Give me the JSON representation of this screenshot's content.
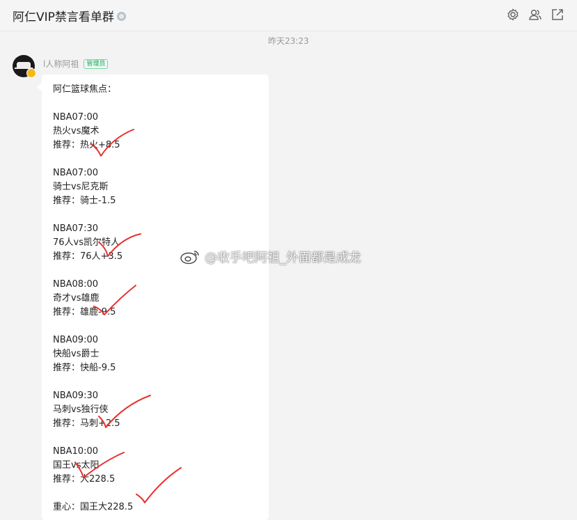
{
  "header": {
    "title": "阿仁VIP禁言看单群",
    "icons": [
      "gear-icon",
      "members-icon",
      "share-icon"
    ]
  },
  "timestamp": "昨天23:23",
  "message": {
    "sender": "l人称阿祖",
    "role": "管理员",
    "title": "阿仁篮球焦点：",
    "games": [
      {
        "time": "NBA07:00",
        "matchup": "热火vs魔术",
        "pick": "推荐：热火+8.5"
      },
      {
        "time": "NBA07:00",
        "matchup": "骑士vs尼克斯",
        "pick": "推荐：骑士-1.5"
      },
      {
        "time": "NBA07:30",
        "matchup": "76人vs凯尔特人",
        "pick": "推荐：76人+3.5"
      },
      {
        "time": "NBA08:00",
        "matchup": "奇才vs雄鹿",
        "pick": "推荐：雄鹿-9.5"
      },
      {
        "time": "NBA09:00",
        "matchup": "快船vs爵士",
        "pick": "推荐：快船-9.5"
      },
      {
        "time": "NBA09:30",
        "matchup": "马刺vs独行侠",
        "pick": "推荐：马刺+2.5"
      },
      {
        "time": "NBA10:00",
        "matchup": "国王vs太阳",
        "pick": "推荐：大228.5"
      }
    ],
    "footer": "重心：国王大228.5"
  },
  "watermark": "@收手吧阿祖_外面都是成龙",
  "colors": {
    "check_mark": "#e8312f",
    "admin_tag": "#19a35f",
    "badge": "#f6b818"
  }
}
